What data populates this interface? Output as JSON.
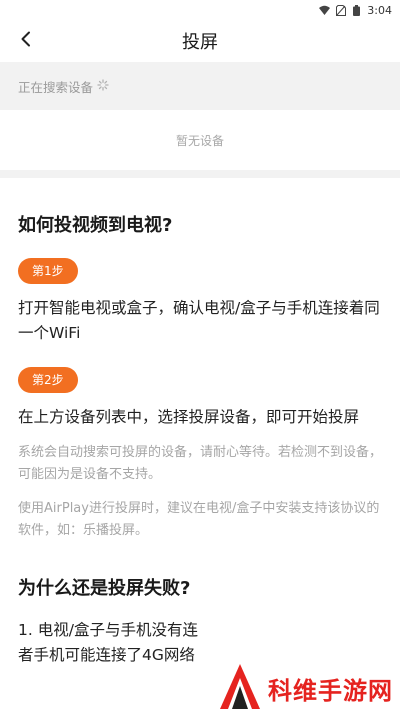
{
  "status_bar": {
    "time": "3:04"
  },
  "nav": {
    "title": "投屏",
    "back_icon": "chevron-left-icon"
  },
  "search": {
    "label": "正在搜索设备",
    "empty_text": "暂无设备"
  },
  "guide": {
    "title": "如何投视频到电视?",
    "steps": [
      {
        "badge": "第1步",
        "text": "打开智能电视或盒子，确认电视/盒子与手机连接着同一个WiFi"
      },
      {
        "badge": "第2步",
        "text": "在上方设备列表中，选择投屏设备，即可开始投屏"
      }
    ],
    "notes": [
      "系统会自动搜索可投屏的设备，请耐心等待。若检测不到设备，可能因为是设备不支持。",
      "使用AirPlay进行投屏时，建议在电视/盒子中安装支持该协议的软件，如：乐播投屏。"
    ],
    "title2": "为什么还是投屏失败?",
    "reasons": [
      "1. 电视/盒子与手机没有连",
      "者手机可能连接了4G网络"
    ]
  },
  "watermark": {
    "text": "科维手游网"
  },
  "colors": {
    "accent": "#f26f21",
    "watermark": "#e5231f"
  }
}
